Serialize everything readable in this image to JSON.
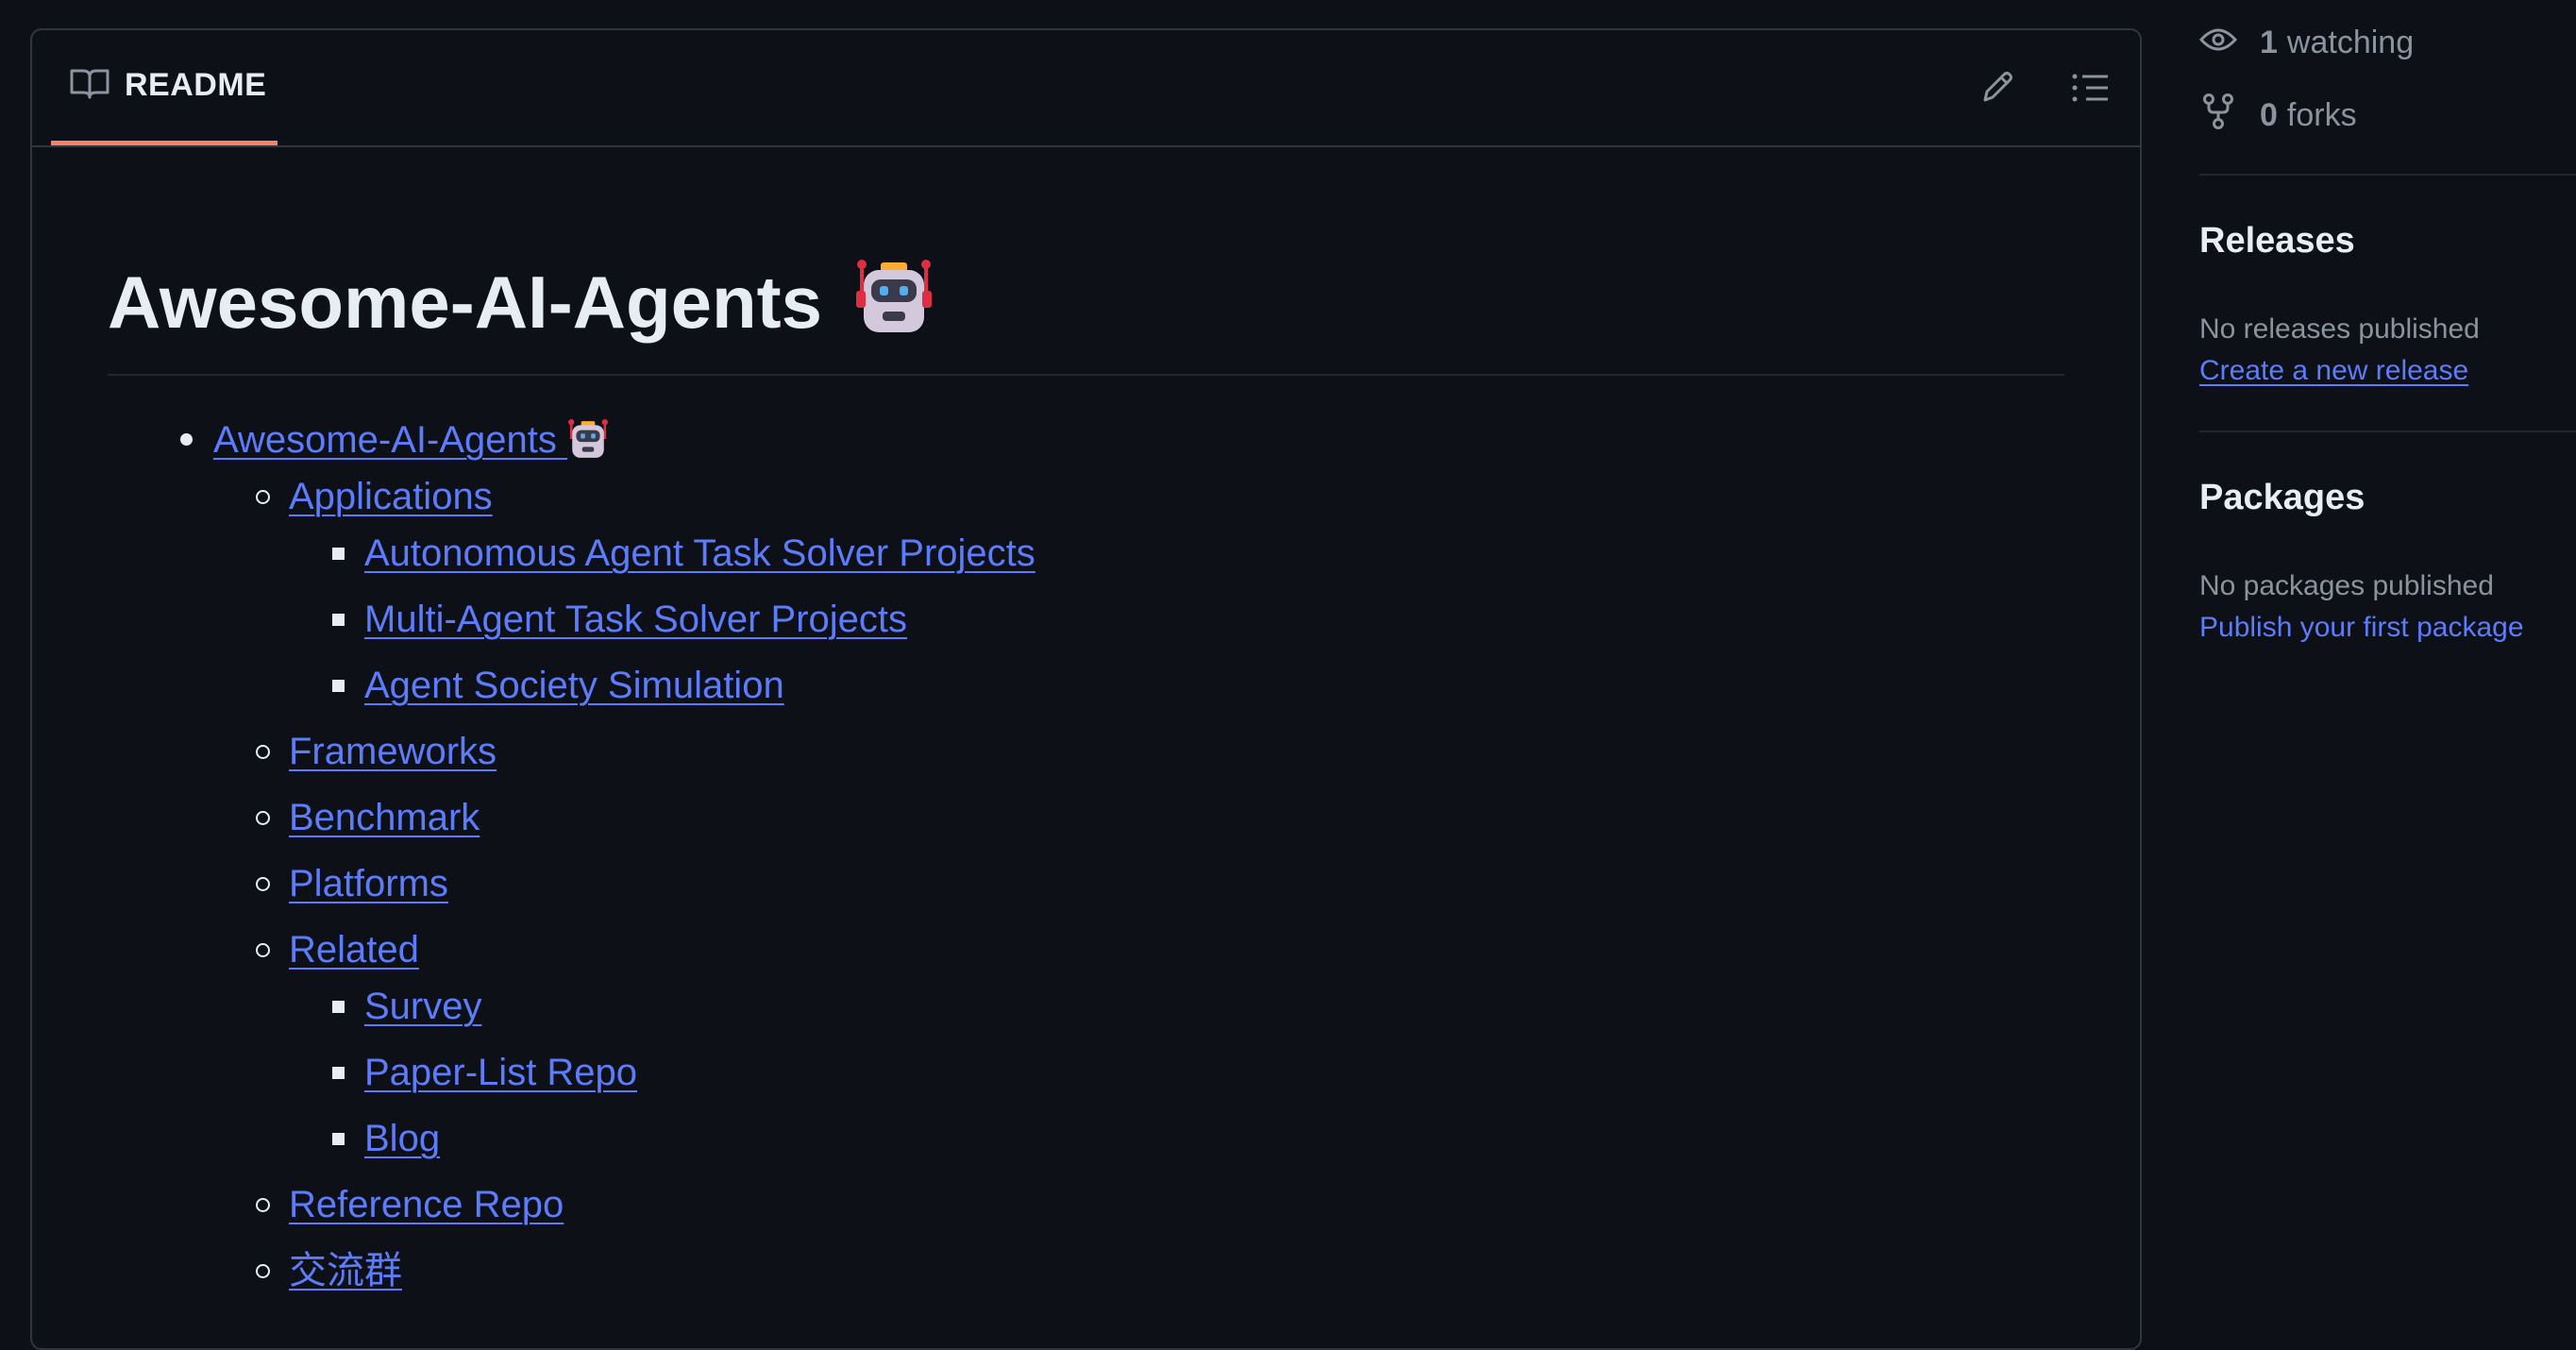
{
  "readme": {
    "tab_label": "README",
    "title": "Awesome-AI-Agents",
    "title_emoji": "robot-face-icon",
    "toc": [
      {
        "level": 1,
        "label": "Awesome-AI-Agents",
        "has_emoji": true
      },
      {
        "level": 2,
        "label": "Applications"
      },
      {
        "level": 3,
        "label": "Autonomous Agent Task Solver Projects"
      },
      {
        "level": 3,
        "label": "Multi-Agent Task Solver Projects"
      },
      {
        "level": 3,
        "label": "Agent Society Simulation"
      },
      {
        "level": 2,
        "label": "Frameworks"
      },
      {
        "level": 2,
        "label": "Benchmark"
      },
      {
        "level": 2,
        "label": "Platforms"
      },
      {
        "level": 2,
        "label": "Related"
      },
      {
        "level": 3,
        "label": "Survey"
      },
      {
        "level": 3,
        "label": "Paper-List Repo"
      },
      {
        "level": 3,
        "label": "Blog"
      },
      {
        "level": 2,
        "label": "Reference Repo"
      },
      {
        "level": 2,
        "label": "交流群"
      }
    ]
  },
  "sidebar": {
    "watching": {
      "count": "1",
      "label": "watching"
    },
    "forks": {
      "count": "0",
      "label": "forks"
    },
    "releases": {
      "heading": "Releases",
      "empty_text": "No releases published",
      "link": "Create a new release"
    },
    "packages": {
      "heading": "Packages",
      "empty_text": "No packages published",
      "link": "Publish your first package"
    }
  },
  "colors": {
    "background": "#0d1117",
    "border": "#30363d",
    "link": "#5c7cfa",
    "tab_accent": "#f78166",
    "muted_text": "#8b949e",
    "text": "#e6edf3"
  }
}
